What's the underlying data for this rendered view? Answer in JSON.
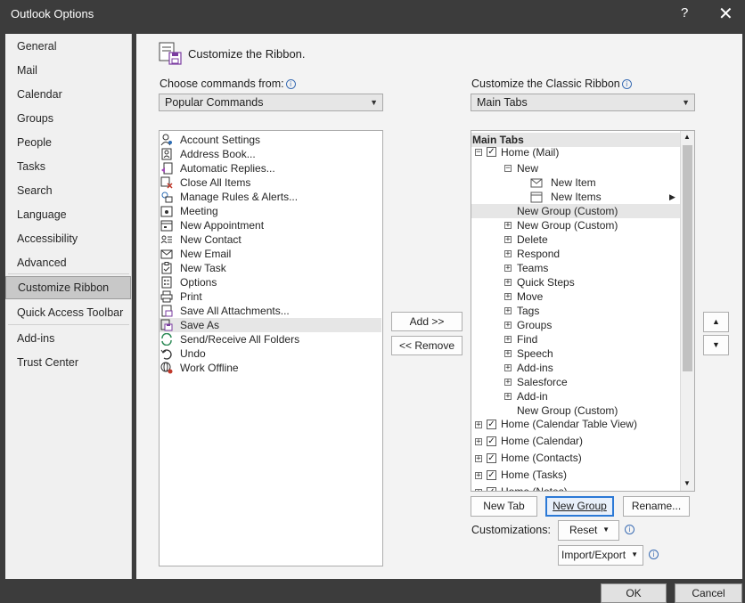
{
  "window": {
    "title": "Outlook Options",
    "help_label": "?",
    "close_label": "✕"
  },
  "sidebar": {
    "items": [
      {
        "label": "General"
      },
      {
        "label": "Mail"
      },
      {
        "label": "Calendar"
      },
      {
        "label": "Groups"
      },
      {
        "label": "People"
      },
      {
        "label": "Tasks"
      },
      {
        "label": "Search"
      },
      {
        "label": "Language"
      },
      {
        "label": "Accessibility"
      },
      {
        "label": "Advanced"
      },
      {
        "label": "Customize Ribbon"
      },
      {
        "label": "Quick Access Toolbar"
      },
      {
        "label": "Add-ins"
      },
      {
        "label": "Trust Center"
      }
    ],
    "selected": "Customize Ribbon"
  },
  "main": {
    "heading": "Customize the Ribbon.",
    "choose_label": "Choose commands from:",
    "choose_value": "Popular Commands",
    "customize_label": "Customize the Classic Ribbon",
    "customize_value": "Main Tabs",
    "commands": [
      {
        "label": "Account Settings",
        "icon": "account-settings-icon"
      },
      {
        "label": "Address Book...",
        "icon": "address-book-icon"
      },
      {
        "label": "Automatic Replies...",
        "icon": "automatic-replies-icon"
      },
      {
        "label": "Close All Items",
        "icon": "close-all-items-icon"
      },
      {
        "label": "Manage Rules & Alerts...",
        "icon": "rules-icon"
      },
      {
        "label": "Meeting",
        "icon": "meeting-icon"
      },
      {
        "label": "New Appointment",
        "icon": "appointment-icon"
      },
      {
        "label": "New Contact",
        "icon": "contact-card-icon"
      },
      {
        "label": "New Email",
        "icon": "envelope-icon"
      },
      {
        "label": "New Task",
        "icon": "clipboard-icon"
      },
      {
        "label": "Options",
        "icon": "options-icon"
      },
      {
        "label": "Print",
        "icon": "printer-icon"
      },
      {
        "label": "Save All Attachments...",
        "icon": "attachment-icon"
      },
      {
        "label": "Save As",
        "icon": "save-as-icon"
      },
      {
        "label": "Send/Receive All Folders",
        "icon": "send-receive-icon"
      },
      {
        "label": "Undo",
        "icon": "undo-icon"
      },
      {
        "label": "Work Offline",
        "icon": "work-offline-icon"
      }
    ],
    "selected_command": "Save As",
    "add_button": "Add >>",
    "remove_button": "<< Remove",
    "tree": {
      "header": "Main Tabs",
      "home_mail": "Home (Mail)",
      "new_group": "New",
      "new_item": "New Item",
      "new_items": "New Items",
      "custom_group_selected": "New Group (Custom)",
      "groups": [
        "New Group (Custom)",
        "Delete",
        "Respond",
        "Teams",
        "Quick Steps",
        "Move",
        "Tags",
        "Groups",
        "Find",
        "Speech",
        "Add-ins",
        "Salesforce",
        "Add-in"
      ],
      "custom_group_last": "New Group (Custom)",
      "tabs": [
        "Home (Calendar Table View)",
        "Home (Calendar)",
        "Home (Contacts)",
        "Home (Tasks)",
        "Home (Notes)"
      ]
    },
    "new_tab_button": "New Tab",
    "new_group_button": "New Group",
    "rename_button": "Rename...",
    "customizations_label": "Customizations:",
    "reset_button": "Reset",
    "import_export_button": "Import/Export",
    "move_up_label": "▲",
    "move_down_label": "▼"
  },
  "footer": {
    "ok": "OK",
    "cancel": "Cancel"
  }
}
